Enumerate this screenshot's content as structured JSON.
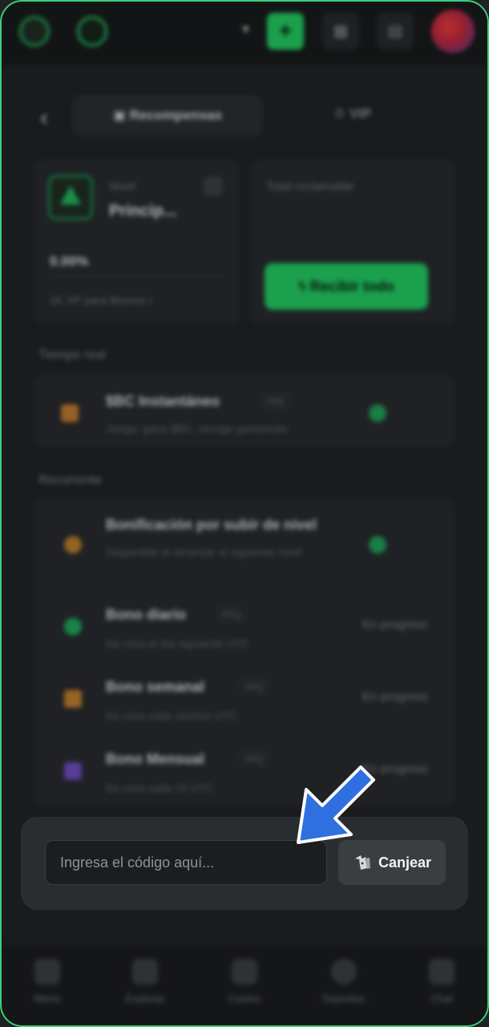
{
  "header": {
    "deposit_label": "+",
    "icons": [
      "logo-icon",
      "brand-icon",
      "chevron-down-icon",
      "plus-icon",
      "grid-icon",
      "document-icon",
      "avatar"
    ]
  },
  "tabs": {
    "back_icon": "‹",
    "active_label": "Recompensas",
    "vip_label": "VIP"
  },
  "level_card": {
    "level_label": "Nivel",
    "level_name": "Princip...",
    "progress_percent": "0.00%",
    "progress_value": 0,
    "next_level_text": "1K XP para Bronce I"
  },
  "claim_card": {
    "label": "Total reclamable",
    "button_label": "Recibir todo"
  },
  "realtime": {
    "section_label": "Tiempo real",
    "item_title": "$BC Instantáneo",
    "item_badge": "FAQ",
    "item_sub": "Juega, gana $BC, recoge ganancias"
  },
  "recurring": {
    "section_label": "Recurrente",
    "items": [
      {
        "title": "Bonificación por subir de nivel",
        "sub": "Disponible al alcanzar el siguiente nivel",
        "status": "",
        "badge": ""
      },
      {
        "title": "Bono diario",
        "sub": "Se crea el día siguiente UTC",
        "status": "En progreso",
        "badge": "FAQ"
      },
      {
        "title": "Bono semanal",
        "sub": "Se crea cada viernes UTC",
        "status": "En progreso",
        "badge": "FAQ"
      },
      {
        "title": "Bono Mensual",
        "sub": "Se crea cada 15 UTC",
        "status": "En progreso",
        "badge": "FAQ"
      }
    ]
  },
  "redeem": {
    "placeholder": "Ingresa el código aquí...",
    "button_label": "Canjear"
  },
  "bottom_nav": {
    "items": [
      "Menú",
      "Explorar",
      "Casino",
      "Deportes",
      "Chat"
    ]
  },
  "colors": {
    "accent": "#21c45e",
    "background": "#1f2123",
    "arrow": "#2f6fe0"
  }
}
